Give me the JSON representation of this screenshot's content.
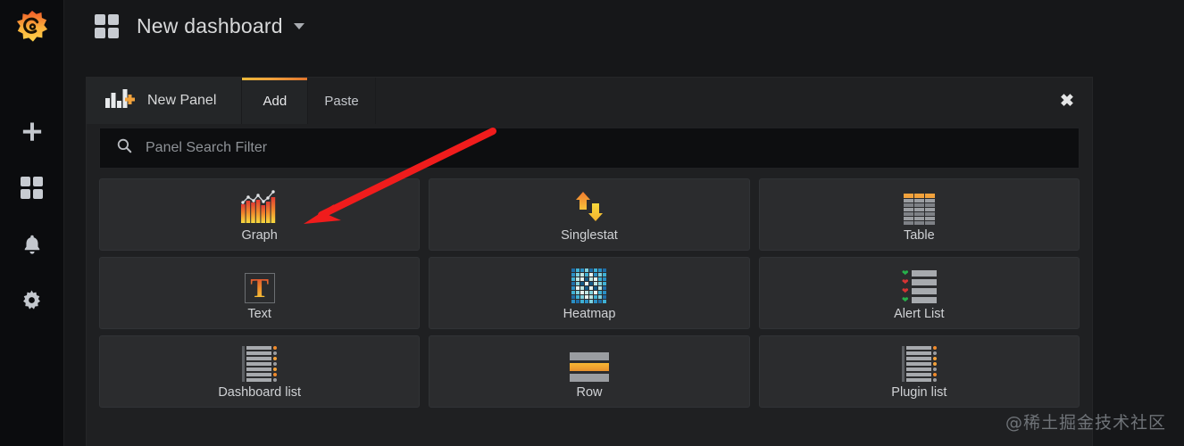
{
  "sidebar": {
    "brand_icon": "grafana-logo",
    "items": [
      {
        "icon": "plus-icon",
        "name": "create"
      },
      {
        "icon": "dashboards-grid-icon",
        "name": "dashboards"
      },
      {
        "icon": "bell-icon",
        "name": "alerting"
      },
      {
        "icon": "gear-icon",
        "name": "configuration"
      }
    ]
  },
  "header": {
    "grid_icon": "dashboards-grid-icon",
    "title": "New dashboard",
    "caret_icon": "chevron-down-icon"
  },
  "add_panel": {
    "panel_tab_icon": "add-panel-icon",
    "panel_tab_label": "New Panel",
    "tabs": [
      {
        "label": "Add",
        "active": true
      },
      {
        "label": "Paste",
        "active": false
      }
    ],
    "close_icon": "close-icon",
    "close_label": "✖",
    "search": {
      "icon": "search-icon",
      "placeholder": "Panel Search Filter",
      "value": ""
    },
    "panel_types": [
      {
        "label": "Graph",
        "icon": "graph-icon"
      },
      {
        "label": "Singlestat",
        "icon": "singlestat-icon"
      },
      {
        "label": "Table",
        "icon": "table-icon"
      },
      {
        "label": "Text",
        "icon": "text-icon"
      },
      {
        "label": "Heatmap",
        "icon": "heatmap-icon"
      },
      {
        "label": "Alert List",
        "icon": "alert-list-icon"
      },
      {
        "label": "Dashboard list",
        "icon": "dashboard-list-icon"
      },
      {
        "label": "Row",
        "icon": "row-icon"
      },
      {
        "label": "Plugin list",
        "icon": "plugin-list-icon"
      }
    ]
  },
  "annotation": {
    "arrow_color": "#f01c1c",
    "arrow_name": "red-pointer-arrow"
  },
  "watermark": {
    "text": "@稀土掘金技术社区"
  },
  "colors": {
    "accent_orange": "#f2a23c",
    "accent_yellow": "#eab839",
    "page_bg": "#161719",
    "panel_bg": "#1f2022",
    "card_bg": "#2b2c2e",
    "text": "#d8d9da"
  }
}
